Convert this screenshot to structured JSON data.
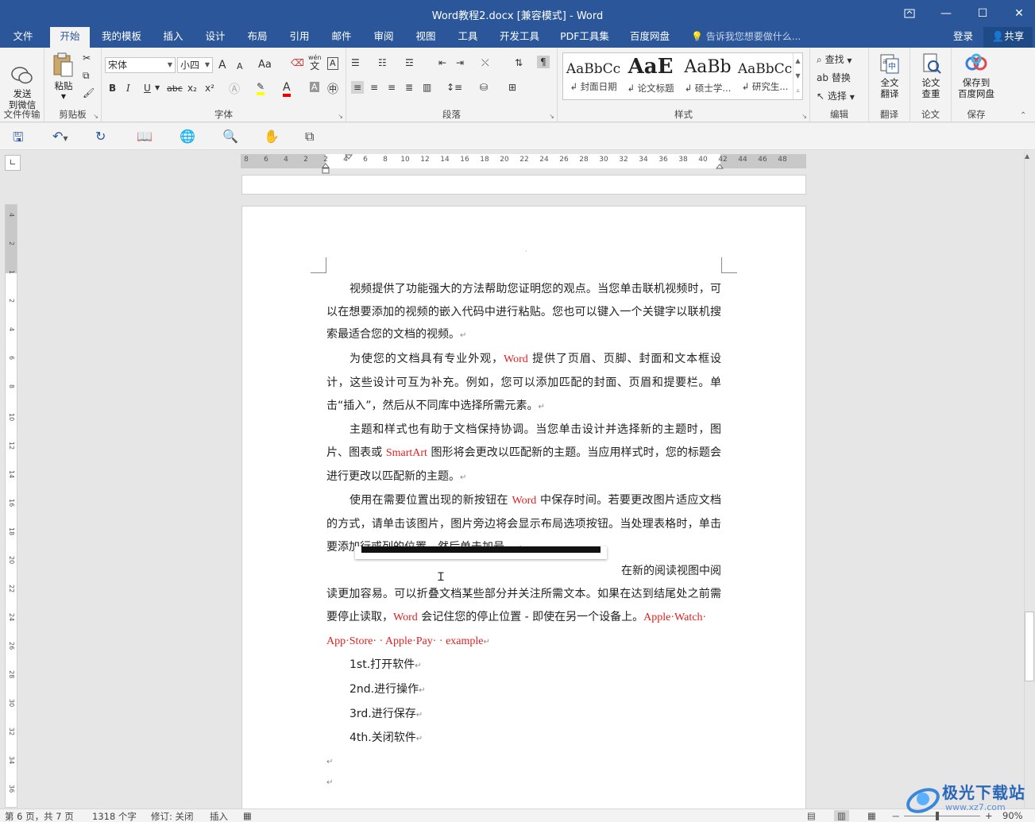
{
  "window": {
    "title": "Word教程2.docx [兼容模式] - Word",
    "restore_ribbon_icon": "ribbon-display-icon",
    "minimize": "—",
    "maximize": "☐",
    "close": "✕"
  },
  "tabs": [
    {
      "label": "文件"
    },
    {
      "label": "开始"
    },
    {
      "label": "我的模板"
    },
    {
      "label": "插入"
    },
    {
      "label": "设计"
    },
    {
      "label": "布局"
    },
    {
      "label": "引用"
    },
    {
      "label": "邮件"
    },
    {
      "label": "审阅"
    },
    {
      "label": "视图"
    },
    {
      "label": "工具"
    },
    {
      "label": "开发工具"
    },
    {
      "label": "PDF工具集"
    },
    {
      "label": "百度网盘"
    }
  ],
  "active_tab": "开始",
  "tell_me": "告诉我您想要做什么...",
  "login": "登录",
  "share": "共享",
  "ribbon": {
    "file_transfer": {
      "button": "发送\n到微信",
      "label": "文件传输"
    },
    "clipboard": {
      "paste": "粘贴",
      "label": "剪贴板"
    },
    "font": {
      "font_name": "宋体",
      "font_size": "小四",
      "label": "字体",
      "grow": "A",
      "shrink": "A",
      "case": "Aa",
      "pinyin_top": "wén",
      "pinyin_char": "文",
      "border_char": "A",
      "bold": "B",
      "italic": "I",
      "underline": "U",
      "strike": "abc",
      "subscript": "x₂",
      "superscript": "x²"
    },
    "paragraph": {
      "label": "段落"
    },
    "styles": {
      "label": "样式",
      "items": [
        {
          "sample": "AaBbCc",
          "name": "↲ 封面日期"
        },
        {
          "sample": "AaE",
          "name": "↲ 论文标题"
        },
        {
          "sample": "AaBb",
          "name": "↲ 硕士学..."
        },
        {
          "sample": "AaBbCc",
          "name": "↲ 研究生..."
        }
      ]
    },
    "editing": {
      "find": "查找",
      "replace": "替换",
      "select": "选择",
      "label": "编辑"
    },
    "translate": {
      "button": "全文\n翻译",
      "label": "翻译"
    },
    "paper": {
      "button": "论文\n查重",
      "label": "论文"
    },
    "save": {
      "button": "保存到\n百度网盘",
      "label": "保存"
    }
  },
  "ruler": {
    "ticks": [
      "8",
      "6",
      "4",
      "2",
      "2",
      "4",
      "6",
      "8",
      "10",
      "12",
      "14",
      "16",
      "18",
      "20",
      "22",
      "24",
      "26",
      "28",
      "30",
      "32",
      "34",
      "36",
      "38",
      "40",
      "42",
      "44",
      "46",
      "48"
    ],
    "vticks": [
      "4",
      "2",
      "1",
      "2",
      "4",
      "6",
      "8",
      "10",
      "12",
      "14",
      "16",
      "18",
      "20",
      "22",
      "24",
      "26",
      "28",
      "30",
      "32",
      "34",
      "36"
    ]
  },
  "document": {
    "top_mark": "·",
    "p1": "视频提供了功能强大的方法帮助您证明您的观点。当您单击联机视频时，可以在想要添加的视频的嵌入代码中进行粘贴。您也可以键入一个关键字以联机搜索最适合您的文档的视频。",
    "p2_a": "为使您的文档具有专业外观，",
    "p2_red": "Word",
    "p2_b": " 提供了页眉、页脚、封面和文本框设计，这些设计可互为补充。例如，您可以添加匹配的封面、页眉和提要栏。单击“插入”，然后从不同库中选择所需元素。",
    "p3_a": "主题和样式也有助于文档保持协调。当您单击设计并选择新的主题时，图片、图表或 ",
    "p3_red": "SmartArt",
    "p3_b": " 图形将会更改以匹配新的主题。当应用样式时，您的标题会进行更改以匹配新的主题。",
    "p4_a": "使用在需要位置出现的新按钮在 ",
    "p4_red": "Word",
    "p4_b": " 中保存时间。若要更改图片适应文档的方式，请单击该图片，图片旁边将会显示布局选项按钮。当处理表格时，单击要添加行或列的位置，然后单击加号。",
    "p5_tail": "在新的阅读视图中阅",
    "p6_a": "读更加容易。可以折叠文档某些部分并关注所需文本。如果在达到结尾处之前需要停止读取，",
    "p6_red": "Word",
    "p6_b": " 会记住您的停止位置 - 即使在另一个设备上。",
    "p6_red2": "Apple·Watch·",
    "p7": "App·Store· · Apple·Pay· · example",
    "list": [
      "1st.打开软件",
      "2nd.进行操作",
      "3rd.进行保存",
      "4th.关闭软件"
    ],
    "para_mark": "↵"
  },
  "status": {
    "page": "第 6 页，共 7 页",
    "words": "1318 个字",
    "revision": "修订: 关闭",
    "insert": "插入",
    "zoom": "90%",
    "zoom_minus": "－",
    "zoom_plus": "+"
  },
  "watermark": {
    "text": "极光下载站",
    "url": "www.xz7.com"
  }
}
